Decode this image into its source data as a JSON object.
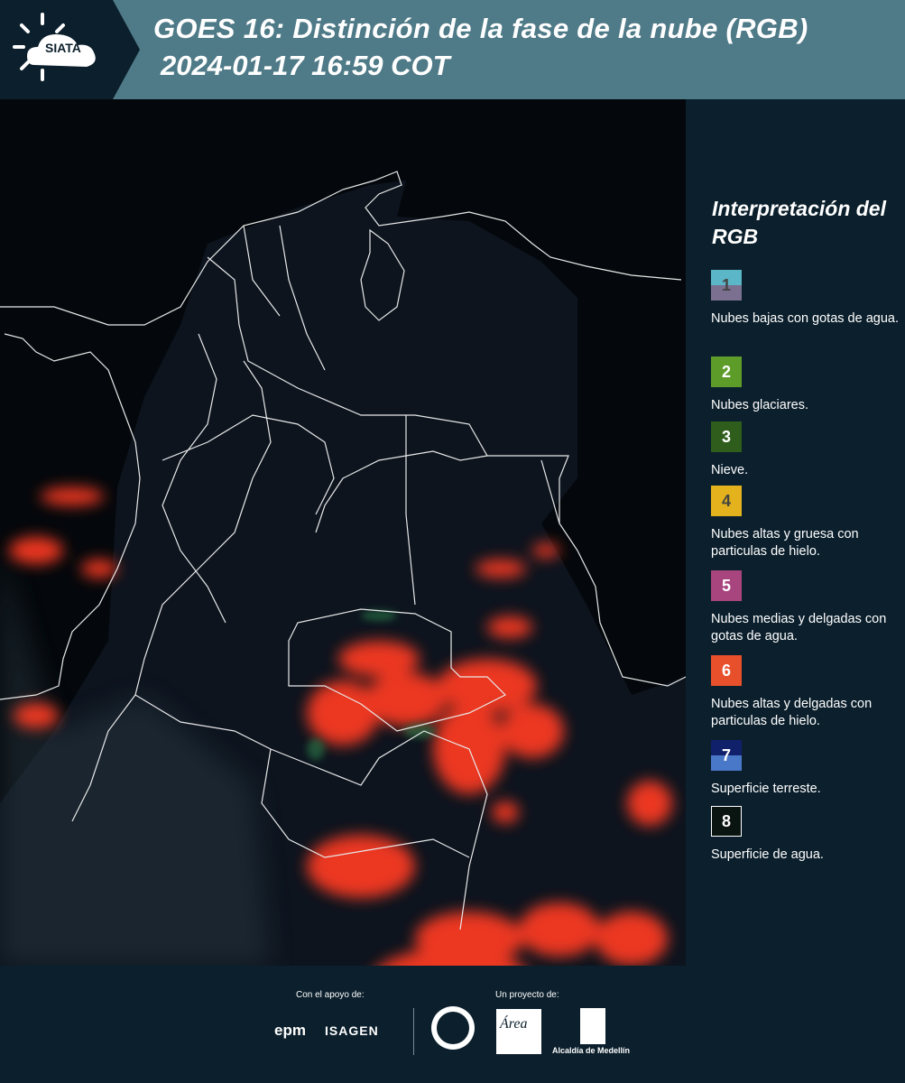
{
  "header": {
    "logo_text": "SIATA",
    "title_line1": "GOES 16: Distinción de la fase de la nube (RGB)",
    "title_line2": "2024-01-17 16:59 COT"
  },
  "legend": {
    "title": "Interpretación del RGB",
    "items": [
      {
        "number": "1",
        "label": "Nubes bajas con gotas de agua.",
        "color_top": "#5bb6c8",
        "color_bottom": "#7b7090",
        "text_color": "#444444"
      },
      {
        "number": "2",
        "label": "Nubes glaciares.",
        "color_top": "#5e9c2a",
        "color_bottom": "#5e9c2a",
        "text_color": "#ffffff"
      },
      {
        "number": "3",
        "label": "Nieve.",
        "color_top": "#2f5e1c",
        "color_bottom": "#2f5e1c",
        "text_color": "#ffffff"
      },
      {
        "number": "4",
        "label": "Nubes altas y gruesa con particulas de hielo.",
        "color_top": "#e3b21c",
        "color_bottom": "#e3b21c",
        "text_color": "#444444"
      },
      {
        "number": "5",
        "label": "Nubes medias y delgadas con gotas de agua.",
        "color_top": "#a8457e",
        "color_bottom": "#a8457e",
        "text_color": "#ffffff"
      },
      {
        "number": "6",
        "label": "Nubes altas y delgadas con particulas de hielo.",
        "color_top": "#e8502c",
        "color_bottom": "#e8502c",
        "text_color": "#ffffff"
      },
      {
        "number": "7",
        "label": "Superficie terreste.",
        "color_top": "#10206a",
        "color_bottom": "#4a78c8",
        "text_color": "#ffffff"
      },
      {
        "number": "8",
        "label": "Superficie de agua.",
        "color_top": "#0a1410",
        "color_bottom": "#0a1410",
        "text_color": "#ffffff"
      }
    ]
  },
  "footer": {
    "support_label": "Con el apoyo de:",
    "project_label": "Un proyecto de:",
    "epm": "epm",
    "isagen": "ISAGEN",
    "area": "Área",
    "alcaldia": "Alcaldía de Medellín"
  },
  "colors": {
    "header_bg": "#4f7a87",
    "panel_bg": "#0b1f2c",
    "cloud_ice": "#ff3a2a"
  }
}
